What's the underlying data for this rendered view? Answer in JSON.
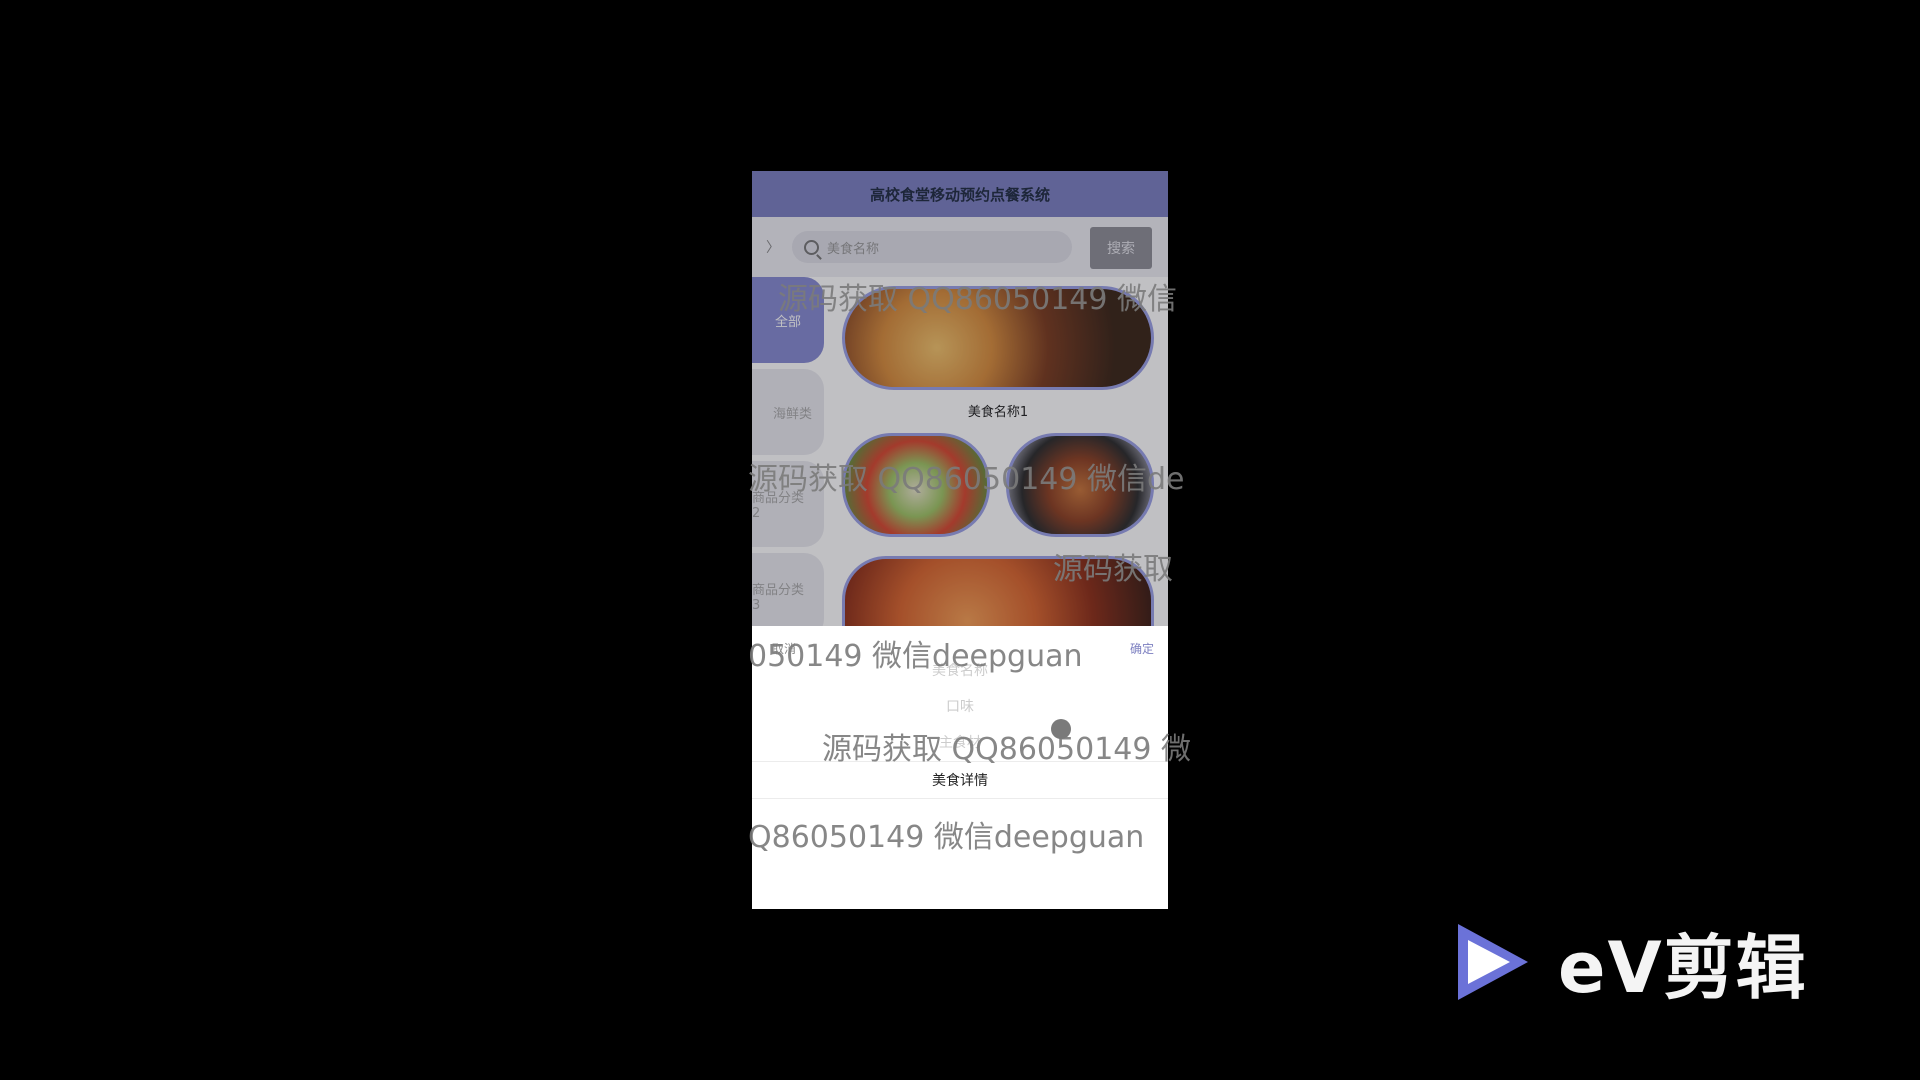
{
  "app": {
    "title": "高校食堂移动预约点餐系统"
  },
  "search": {
    "placeholder": "美食名称",
    "button_label": "搜索",
    "chevron": "〉"
  },
  "categories": [
    {
      "label": "全部",
      "active": true
    },
    {
      "label": "海鲜类",
      "active": false
    },
    {
      "label": "商品分类2",
      "active": false
    },
    {
      "label": "商品分类3",
      "active": false
    }
  ],
  "foods": [
    {
      "caption": "美食名称1"
    }
  ],
  "picker": {
    "cancel_label": "取消",
    "confirm_label": "确定",
    "options": [
      "美食名称",
      "口味",
      "主食材",
      "美食详情"
    ],
    "selected": "美食详情"
  },
  "watermarks": [
    "源码获取 QQ86050149 微信",
    "源码获取 QQ86050149 微信de",
    "源码获取",
    "050149 微信deepguan",
    "源码获取 QQ86050149 微",
    "Q86050149 微信deepguan"
  ],
  "brand": {
    "logo_text": "eV剪辑"
  },
  "colors": {
    "header": "#7b7fc1",
    "accent": "#8589d1",
    "confirm": "#7c7fc0"
  },
  "icons": {
    "search": "search-icon",
    "chevron": "chevron-right-icon",
    "logo": "play-icon"
  }
}
